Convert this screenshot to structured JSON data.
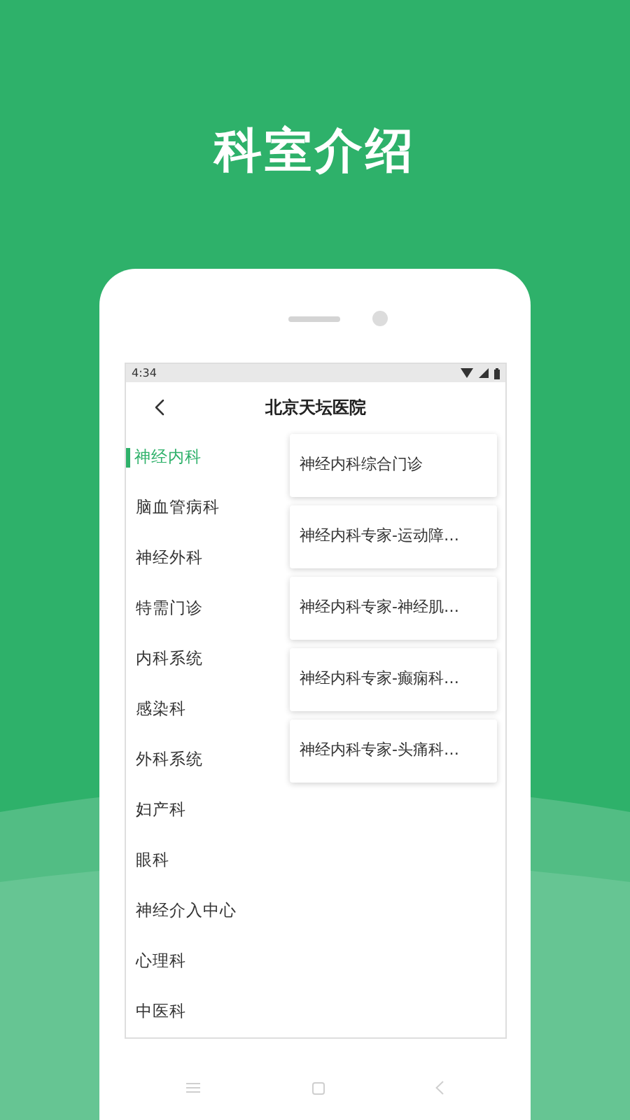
{
  "headline": "科室介绍",
  "status_bar": {
    "time": "4:34"
  },
  "header": {
    "title": "北京天坛医院"
  },
  "departments": [
    {
      "label": "神经内科",
      "selected": true
    },
    {
      "label": "脑血管病科",
      "selected": false
    },
    {
      "label": "神经外科",
      "selected": false
    },
    {
      "label": "特需门诊",
      "selected": false
    },
    {
      "label": "内科系统",
      "selected": false
    },
    {
      "label": "感染科",
      "selected": false
    },
    {
      "label": "外科系统",
      "selected": false
    },
    {
      "label": "妇产科",
      "selected": false
    },
    {
      "label": "眼科",
      "selected": false
    },
    {
      "label": "神经介入中心",
      "selected": false
    },
    {
      "label": "心理科",
      "selected": false
    },
    {
      "label": "中医科",
      "selected": false
    }
  ],
  "clinics": [
    "神经内科综合门诊",
    "神经内科专家-运动障…",
    "神经内科专家-神经肌…",
    "神经内科专家-癫痫科…",
    "神经内科专家-头痛科…"
  ]
}
